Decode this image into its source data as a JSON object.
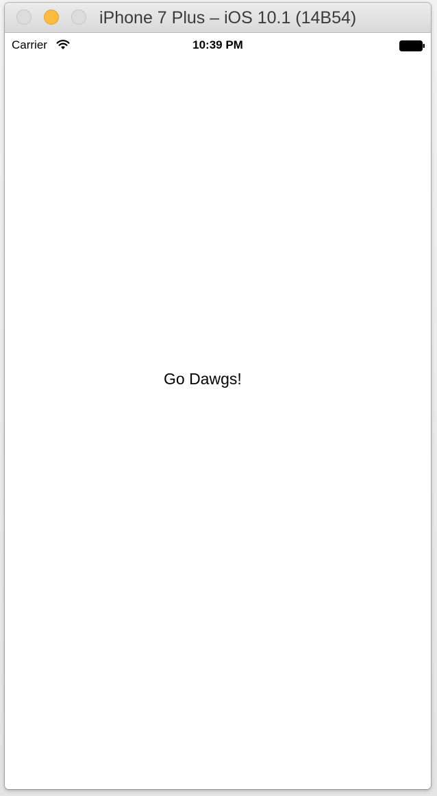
{
  "window": {
    "title": "iPhone 7 Plus – iOS 10.1 (14B54)",
    "buttons": {
      "close": "close-button",
      "minimize": "minimize-button",
      "zoom": "zoom-button"
    },
    "colors": {
      "minimize": "#fdbc40",
      "inactive_button": "#dcdcdc"
    }
  },
  "status_bar": {
    "carrier": "Carrier",
    "time": "10:39 PM",
    "icons": [
      "wifi-icon",
      "battery-icon"
    ]
  },
  "content": {
    "label": "Go Dawgs!"
  }
}
